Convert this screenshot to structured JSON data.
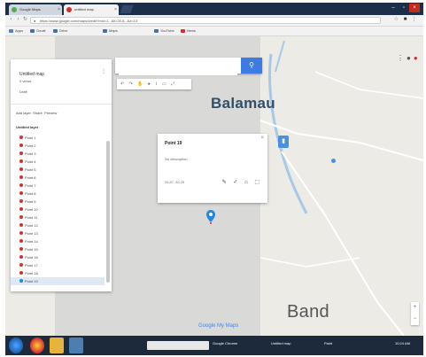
{
  "browser": {
    "tabs": [
      {
        "label": "Google Maps",
        "active": false
      },
      {
        "label": "untitled map",
        "active": true
      }
    ],
    "window_controls": [
      "minimize",
      "maximize",
      "close"
    ],
    "address": "https://www.google.com/maps/d/edit?mid=1...&ll=26.8...&z=13",
    "bookmarks": [
      "Apps",
      "Gmail",
      "Drive",
      "Maps",
      "YouTube",
      "News"
    ]
  },
  "sidebar": {
    "title": "Untitled map",
    "subtitle": "0 views",
    "meta": "Draft",
    "layer_header": "Untitled layer",
    "layer_tools": [
      "Add layer",
      "Share",
      "Preview"
    ],
    "items": [
      "Point 1",
      "Point 2",
      "Point 3",
      "Point 4",
      "Point 5",
      "Point 6",
      "Point 7",
      "Point 8",
      "Point 9",
      "Point 10",
      "Point 11",
      "Point 12",
      "Point 13",
      "Point 14",
      "Point 15",
      "Point 16",
      "Point 17",
      "Point 18"
    ],
    "selected_item": "Point 19"
  },
  "search": {
    "placeholder": "",
    "button_icon": "search-icon"
  },
  "map": {
    "toolbar_symbols": "↶ ↷ ✋ ● ⌇ ▭ ⤢",
    "labels": {
      "north": "Balamau",
      "south": "Band"
    },
    "logo": "Google My Maps"
  },
  "info_card": {
    "title": "Point 19",
    "description": "No description",
    "coords": "26.87, 80.25",
    "actions": "✎ ✓ ⌂ ⬚"
  },
  "taskbar": {
    "items": [
      "Google Chrome",
      "Untitled map",
      "Paint"
    ],
    "clock": "10:24 AM"
  },
  "colors": {
    "accent": "#3b7be2",
    "pin": "#d32f2f",
    "taskbar": "#1c2a3c",
    "tabstrip": "#1b2e4a"
  }
}
